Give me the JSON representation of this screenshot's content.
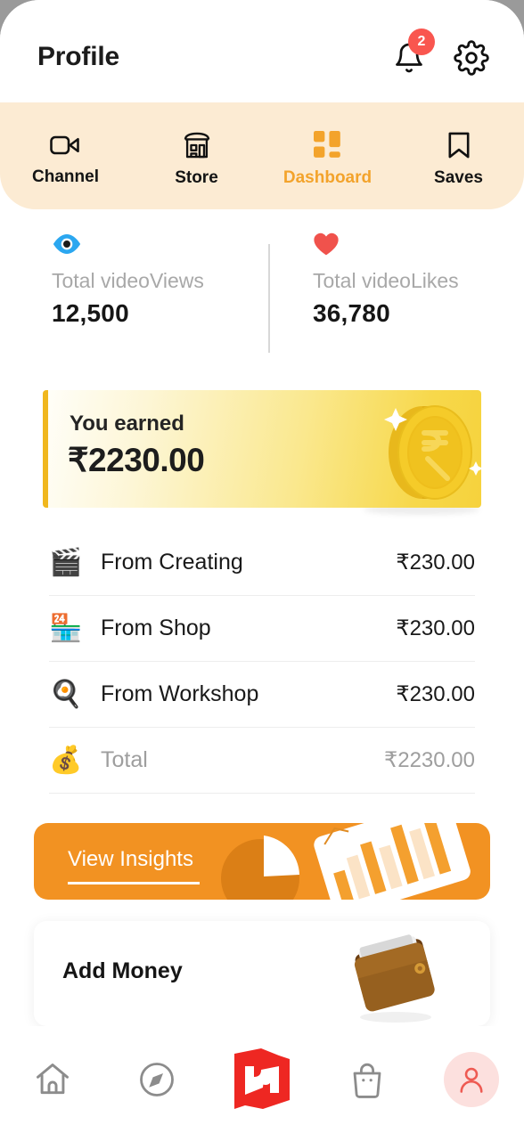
{
  "header": {
    "title": "Profile",
    "notification_icon": "bell-icon",
    "notification_count": "2",
    "settings_icon": "gear-icon"
  },
  "tabs": [
    {
      "label": "Channel",
      "icon": "video-camera-icon",
      "active": false
    },
    {
      "label": "Store",
      "icon": "storefront-icon",
      "active": false
    },
    {
      "label": "Dashboard",
      "icon": "grid-icon",
      "active": true
    },
    {
      "label": "Saves",
      "icon": "bookmark-icon",
      "active": false
    }
  ],
  "stats": [
    {
      "label": "Total videoViews",
      "value": "12,500",
      "icon": "eye-icon",
      "color": "#2BA7F0"
    },
    {
      "label": "Total videoLikes",
      "value": "36,780",
      "icon": "heart-icon",
      "color": "#F0524C"
    }
  ],
  "earned": {
    "title": "You earned",
    "amount": "₹2230.00",
    "illustration": "rupee-coin-illustration"
  },
  "breakdown": [
    {
      "emoji": "🎬",
      "icon": "clapperboard-icon",
      "label": "From Creating",
      "value": "₹230.00",
      "muted": false
    },
    {
      "emoji": "🏪",
      "icon": "shop-icon",
      "label": "From Shop",
      "value": "₹230.00",
      "muted": false
    },
    {
      "emoji": "🍳",
      "icon": "pan-icon",
      "label": "From Workshop",
      "value": "₹230.00",
      "muted": false
    },
    {
      "emoji": "💰",
      "icon": "money-bag-icon",
      "label": "Total",
      "value": "₹2230.00",
      "muted": true
    }
  ],
  "insights": {
    "label": "View Insights",
    "illustration": "pie-and-bar-chart-illustration"
  },
  "add_money": {
    "label": "Add Money",
    "illustration": "wallet-illustration"
  },
  "bottom_nav": [
    {
      "icon": "home-icon",
      "active": false
    },
    {
      "icon": "compass-icon",
      "active": false
    },
    {
      "icon": "brand-logo",
      "active": false
    },
    {
      "icon": "bag-icon",
      "active": false
    },
    {
      "icon": "person-icon",
      "active": true
    }
  ],
  "colors": {
    "accent_orange": "#F3A32B",
    "banner_orange": "#F29222",
    "tabbar_cream": "#FCEBD3",
    "badge_red": "#F9564F",
    "brand_red": "#EE2722",
    "gold": "#F0B71E"
  }
}
